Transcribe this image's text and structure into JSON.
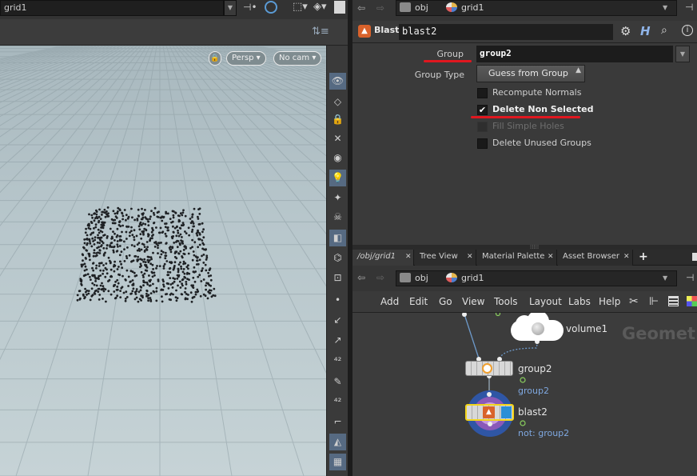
{
  "left_pane": {
    "path": "grid1",
    "viewport": {
      "view_mode": "Persp",
      "camera": "No cam"
    }
  },
  "right_top": {
    "path": [
      "obj",
      "grid1"
    ]
  },
  "params": {
    "node_type": "Blast",
    "node_name": "blast2",
    "group_label": "Group",
    "group_value": "group2",
    "group_type_label": "Group Type",
    "group_type_value": "Guess from Group",
    "checkboxes": [
      {
        "label": "Recompute Normals",
        "checked": false,
        "enabled": true
      },
      {
        "label": "Delete Non Selected",
        "checked": true,
        "enabled": true
      },
      {
        "label": "Fill Simple Holes",
        "checked": false,
        "enabled": false
      },
      {
        "label": "Delete Unused Groups",
        "checked": false,
        "enabled": true
      }
    ],
    "highlight_color": "#e0171f"
  },
  "tabs": [
    {
      "label": "/obj/grid1",
      "active": true
    },
    {
      "label": "Tree View",
      "active": false
    },
    {
      "label": "Material Palette",
      "active": false
    },
    {
      "label": "Asset Browser",
      "active": false
    }
  ],
  "network": {
    "path": [
      "obj",
      "grid1"
    ],
    "menu": [
      "Add",
      "Edit",
      "Go",
      "View",
      "Tools",
      "Layout",
      "Labs",
      "Help"
    ],
    "context_watermark": "Geometry",
    "nodes": [
      {
        "name": "volume1",
        "sublabel": ""
      },
      {
        "name": "group2",
        "sublabel": "group2"
      },
      {
        "name": "blast2",
        "sublabel": "not: group2",
        "selected": true
      }
    ]
  }
}
